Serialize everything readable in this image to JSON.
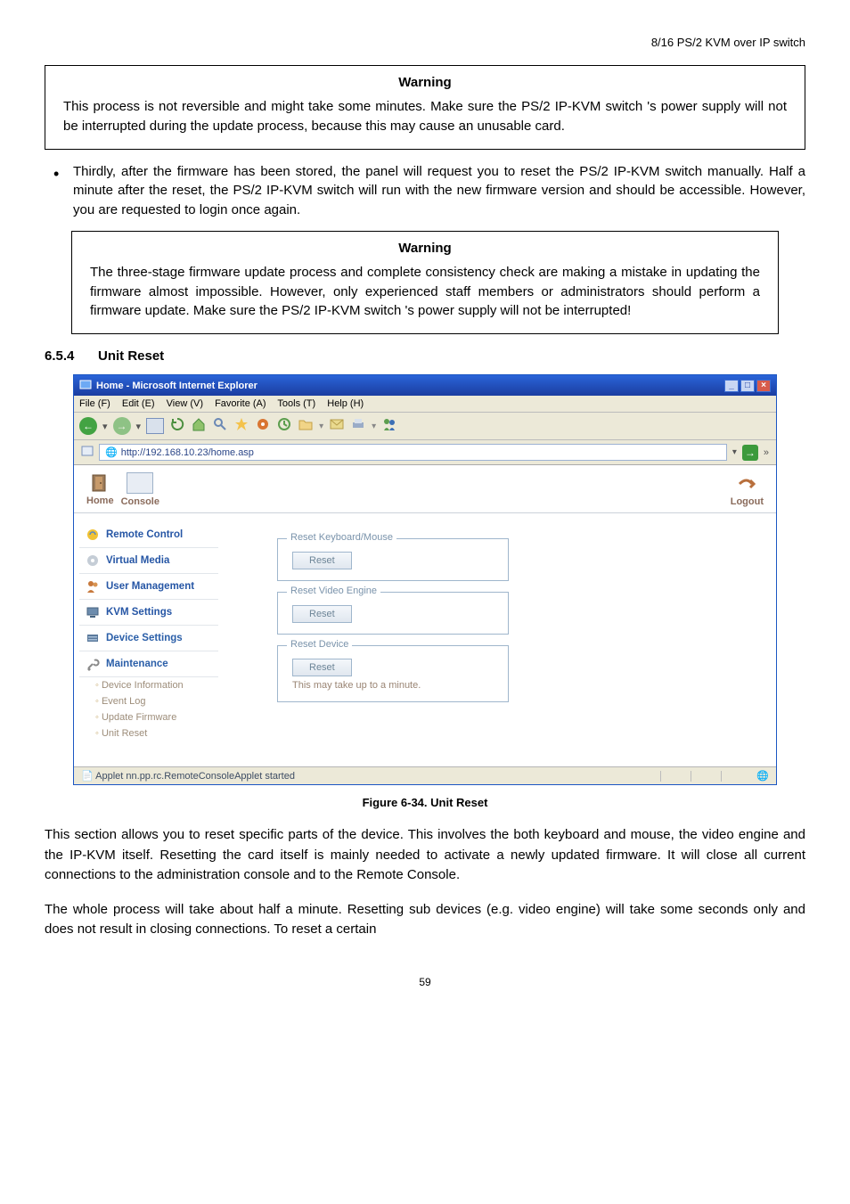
{
  "header_right": "8/16 PS/2 KVM over IP switch",
  "warning1": {
    "title": "Warning",
    "body": "This process is not reversible and might take some minutes. Make sure the PS/2 IP-KVM switch 's power supply will not be interrupted during the update process, because this may cause an unusable card."
  },
  "bullet_text": "Thirdly, after the firmware has been stored, the panel will request you to reset the PS/2 IP-KVM switch manually. Half a minute after the reset, the PS/2 IP-KVM switch will run with the new firmware version and should be accessible. However, you are requested to login once again.",
  "warning2": {
    "title": "Warning",
    "body": "The three-stage firmware update process and complete consistency check are making a mistake in updating the firmware almost impossible. However, only experienced staff members or administrators should perform a firmware update. Make sure the PS/2 IP-KVM switch 's power supply will not be interrupted!"
  },
  "section": {
    "num": "6.5.4",
    "title": "Unit Reset"
  },
  "ie": {
    "title": "Home - Microsoft Internet Explorer",
    "menu": [
      "File (F)",
      "Edit (E)",
      "View (V)",
      "Favorite (A)",
      "Tools (T)",
      "Help (H)"
    ],
    "address": "http://192.168.10.23/home.asp",
    "go": "»",
    "status": "Applet nn.pp.rc.RemoteConsoleApplet started"
  },
  "strip": {
    "home": "Home",
    "console": "Console",
    "logout": "Logout"
  },
  "sidebar": {
    "remote": "Remote Control",
    "vmedia": "Virtual Media",
    "usermgmt": "User Management",
    "kvm": "KVM Settings",
    "devset": "Device Settings",
    "maint": "Maintenance",
    "sub": [
      "Device Information",
      "Event Log",
      "Update Firmware",
      "Unit Reset"
    ]
  },
  "panels": {
    "kb": {
      "legend": "Reset Keyboard/Mouse",
      "btn": "Reset"
    },
    "video": {
      "legend": "Reset Video Engine",
      "btn": "Reset"
    },
    "device": {
      "legend": "Reset Device",
      "btn": "Reset",
      "note": "This may take up to a minute."
    }
  },
  "fig_caption": "Figure 6-34. Unit Reset",
  "para1": "This section allows you to reset specific parts of the device. This involves the both keyboard and mouse, the video engine and the IP-KVM itself. Resetting the card itself is mainly needed to activate a newly updated firmware. It will close all current connections to the administration console and to the Remote Console.",
  "para2": "The whole process will take about half a minute. Resetting sub devices (e.g. video engine) will take some seconds only and does not result in closing connections. To reset a certain",
  "page_num": "59"
}
